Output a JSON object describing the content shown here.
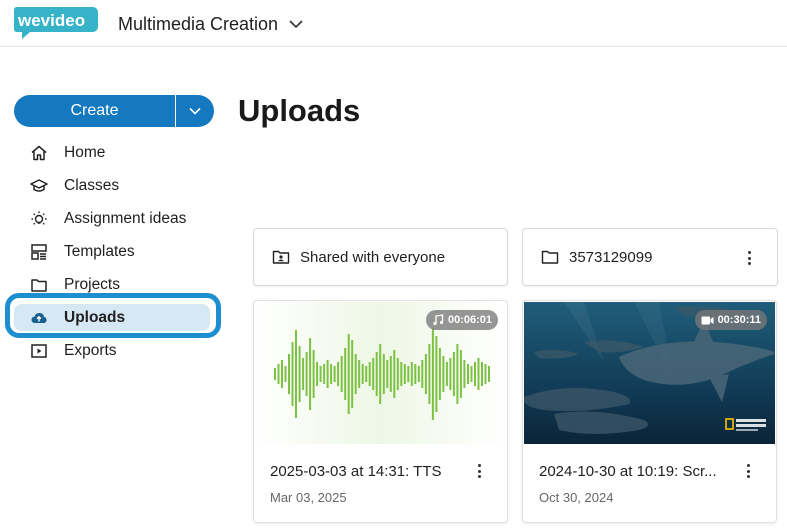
{
  "header": {
    "logo_text": "wevideo",
    "workspace_name": "Multimedia Creation"
  },
  "sidebar": {
    "create_label": "Create",
    "items": [
      {
        "label": "Home",
        "icon": "home-icon"
      },
      {
        "label": "Classes",
        "icon": "classes-icon"
      },
      {
        "label": "Assignment ideas",
        "icon": "lightbulb-icon"
      },
      {
        "label": "Templates",
        "icon": "templates-icon"
      },
      {
        "label": "Projects",
        "icon": "folder-icon"
      },
      {
        "label": "Uploads",
        "icon": "cloud-upload-icon",
        "active": true
      },
      {
        "label": "Exports",
        "icon": "play-box-icon"
      }
    ]
  },
  "main": {
    "title": "Uploads",
    "folders": [
      {
        "label": "Shared with everyone",
        "icon": "shared-folder-icon"
      },
      {
        "label": "3573129099",
        "icon": "folder-icon"
      }
    ],
    "media": [
      {
        "title": "2025-03-03 at 14:31: TTS",
        "date": "Mar 03, 2025",
        "duration": "00:06:01",
        "type": "audio"
      },
      {
        "title": "2024-10-30 at 10:19: Scr...",
        "date": "Oct 30, 2024",
        "duration": "00:30:11",
        "type": "video"
      }
    ]
  },
  "colors": {
    "accent": "#1579c0",
    "active_ring": "#1d8fd1",
    "active_bg": "#d6e8f4",
    "waveform": "#7cc242",
    "logo_teal": "#36b3c9"
  }
}
